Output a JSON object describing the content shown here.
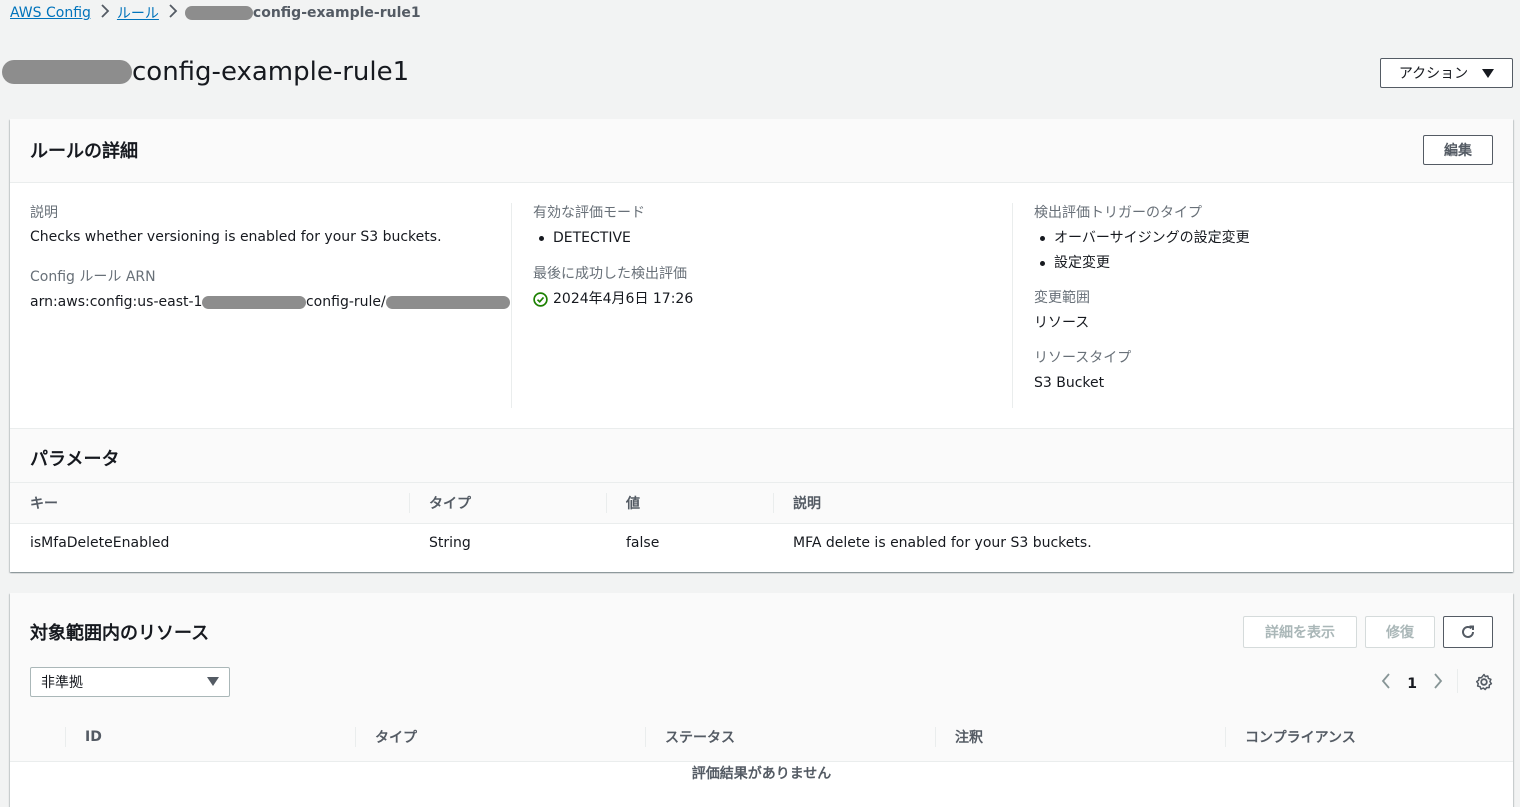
{
  "breadcrumb": {
    "root": "AWS Config",
    "rules": "ルール",
    "current_suffix": "config-example-rule1"
  },
  "page": {
    "title_suffix": "config-example-rule1",
    "actions_label": "アクション"
  },
  "rule_details": {
    "title": "ルールの詳細",
    "edit_label": "編集",
    "description_label": "説明",
    "description_value": "Checks whether versioning is enabled for your S3 buckets.",
    "arn_label": "Config ルール ARN",
    "arn_prefix": "arn:aws:config:us-east-1",
    "arn_mid": "config-rule/",
    "eval_mode_label": "有効な評価モード",
    "eval_mode_items": [
      "DETECTIVE"
    ],
    "last_eval_label": "最後に成功した検出評価",
    "last_eval_value": "2024年4月6日 17:26",
    "trigger_label": "検出評価トリガーのタイプ",
    "trigger_items": [
      "オーバーサイジングの設定変更",
      "設定変更"
    ],
    "scope_label": "変更範囲",
    "scope_value": "リソース",
    "resource_type_label": "リソースタイプ",
    "resource_type_value": "S3 Bucket"
  },
  "parameters": {
    "title": "パラメータ",
    "columns": [
      "キー",
      "タイプ",
      "値",
      "説明"
    ],
    "rows": [
      [
        "isMfaDeleteEnabled",
        "String",
        "false",
        "MFA delete is enabled for your S3 buckets."
      ]
    ]
  },
  "resources": {
    "title": "対象範囲内のリソース",
    "view_details_label": "詳細を表示",
    "remediate_label": "修復",
    "filter_value": "非準拠",
    "page_number": "1",
    "columns": [
      "ID",
      "タイプ",
      "ステータス",
      "注釈",
      "コンプライアンス"
    ],
    "empty_text": "評価結果がありません"
  },
  "colors": {
    "link": "#0073bb",
    "success": "#1d8102",
    "redaction": "#8d8d8d"
  }
}
